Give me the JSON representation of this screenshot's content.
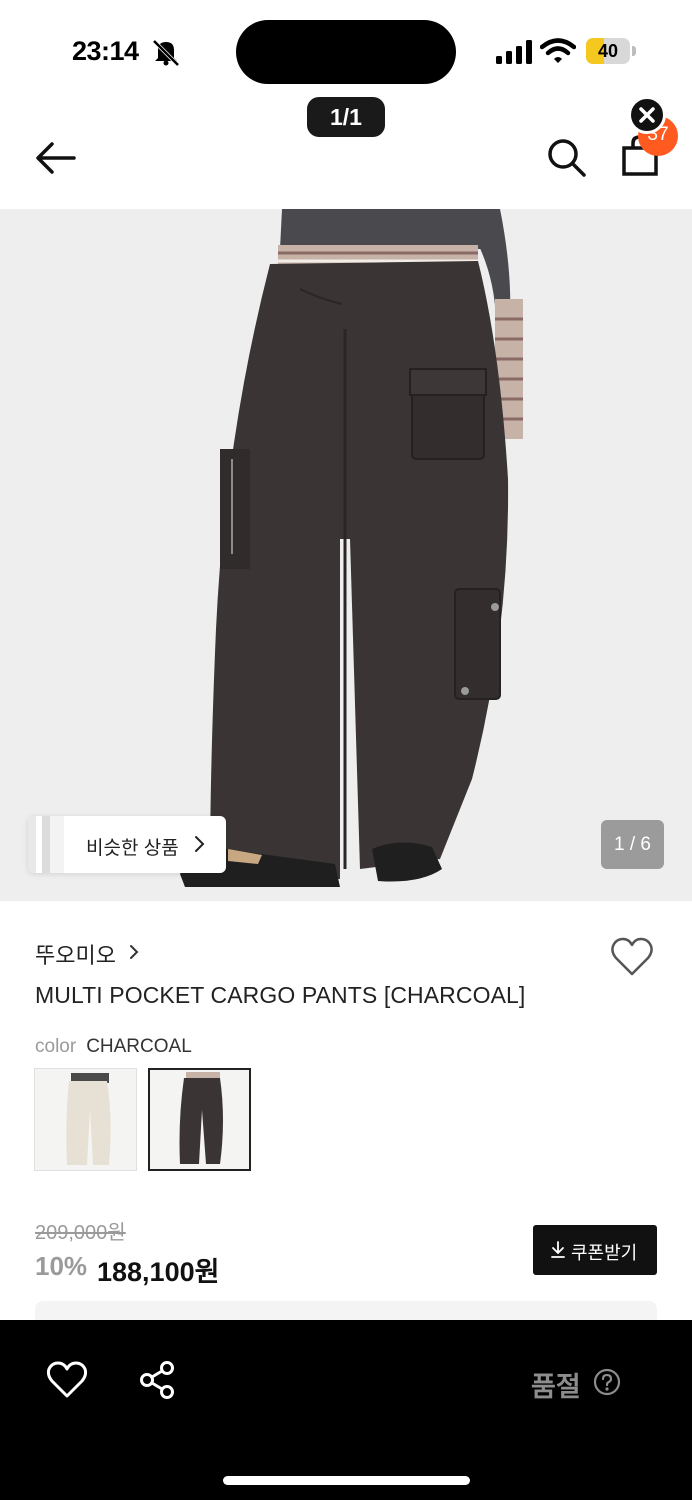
{
  "status_bar": {
    "time": "23:14",
    "battery": "40",
    "battery_level": 0.4
  },
  "viewer": {
    "page_counter": "1/1"
  },
  "header": {
    "cart_count": "37"
  },
  "gallery": {
    "similar_label": "비슷한 상품",
    "image_counter": "1 / 6"
  },
  "product": {
    "brand": "뚜오미오",
    "title": "MULTI POCKET CARGO PANTS [CHARCOAL]",
    "color_key": "color",
    "color_value": "CHARCOAL",
    "swatches": [
      "ivory",
      "charcoal"
    ]
  },
  "price": {
    "original": "209,000원",
    "discount": "10%",
    "sale": "188,100원",
    "coupon_label": "쿠폰받기"
  },
  "bottom_bar": {
    "status": "품절"
  },
  "colors": {
    "accent": "#ff5a1f",
    "battery": "#f4c81f",
    "pants": "#3a3534"
  }
}
